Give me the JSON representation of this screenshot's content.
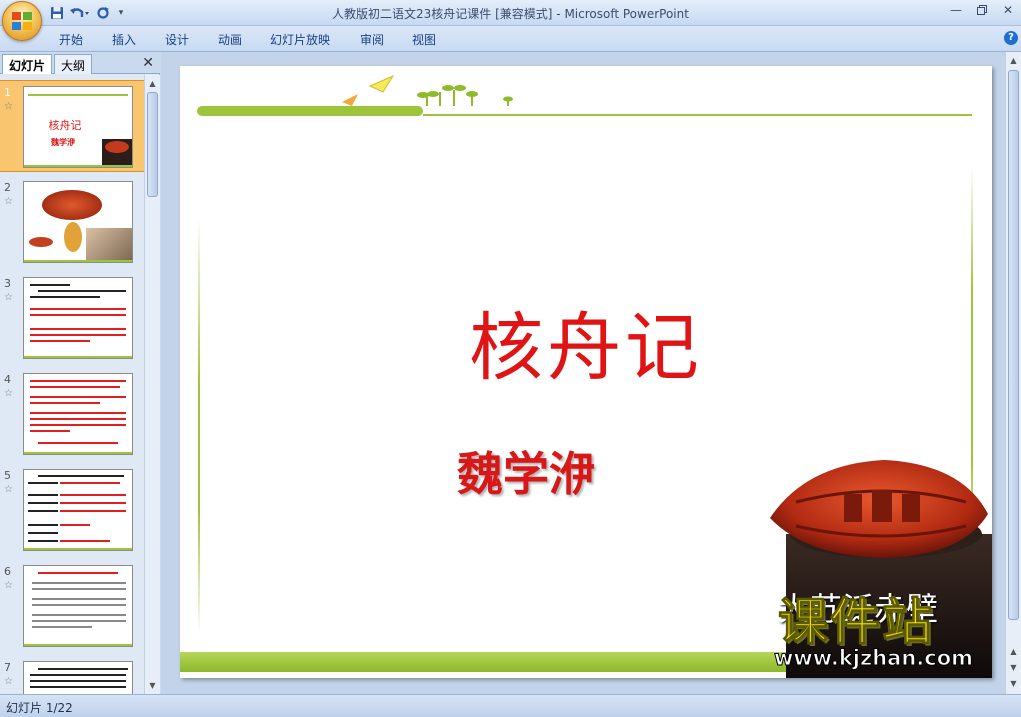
{
  "window": {
    "title": "人教版初二语文23核舟记课件 [兼容模式] - Microsoft PowerPoint"
  },
  "ribbon": {
    "tabs": [
      "开始",
      "插入",
      "设计",
      "动画",
      "幻灯片放映",
      "审阅",
      "视图"
    ]
  },
  "pane": {
    "tabs": [
      "幻灯片",
      "大纲"
    ],
    "close": "✕",
    "thumbnails": [
      {
        "number": "1",
        "selected": true,
        "title": "核舟记",
        "author": "魏学洢"
      },
      {
        "number": "2",
        "selected": false
      },
      {
        "number": "3",
        "selected": false
      },
      {
        "number": "4",
        "selected": false
      },
      {
        "number": "5",
        "selected": false
      },
      {
        "number": "6",
        "selected": false
      },
      {
        "number": "7",
        "selected": false
      }
    ]
  },
  "slide": {
    "title": "核舟记",
    "author": "魏学洢",
    "caption": "大苏泛赤壁",
    "watermark_cn": "课件站",
    "watermark_url": "www.kjzhan.com",
    "accent_color": "#9dc53c",
    "title_color": "#e01414"
  },
  "status": {
    "slide_counter": "幻灯片 1/22"
  }
}
